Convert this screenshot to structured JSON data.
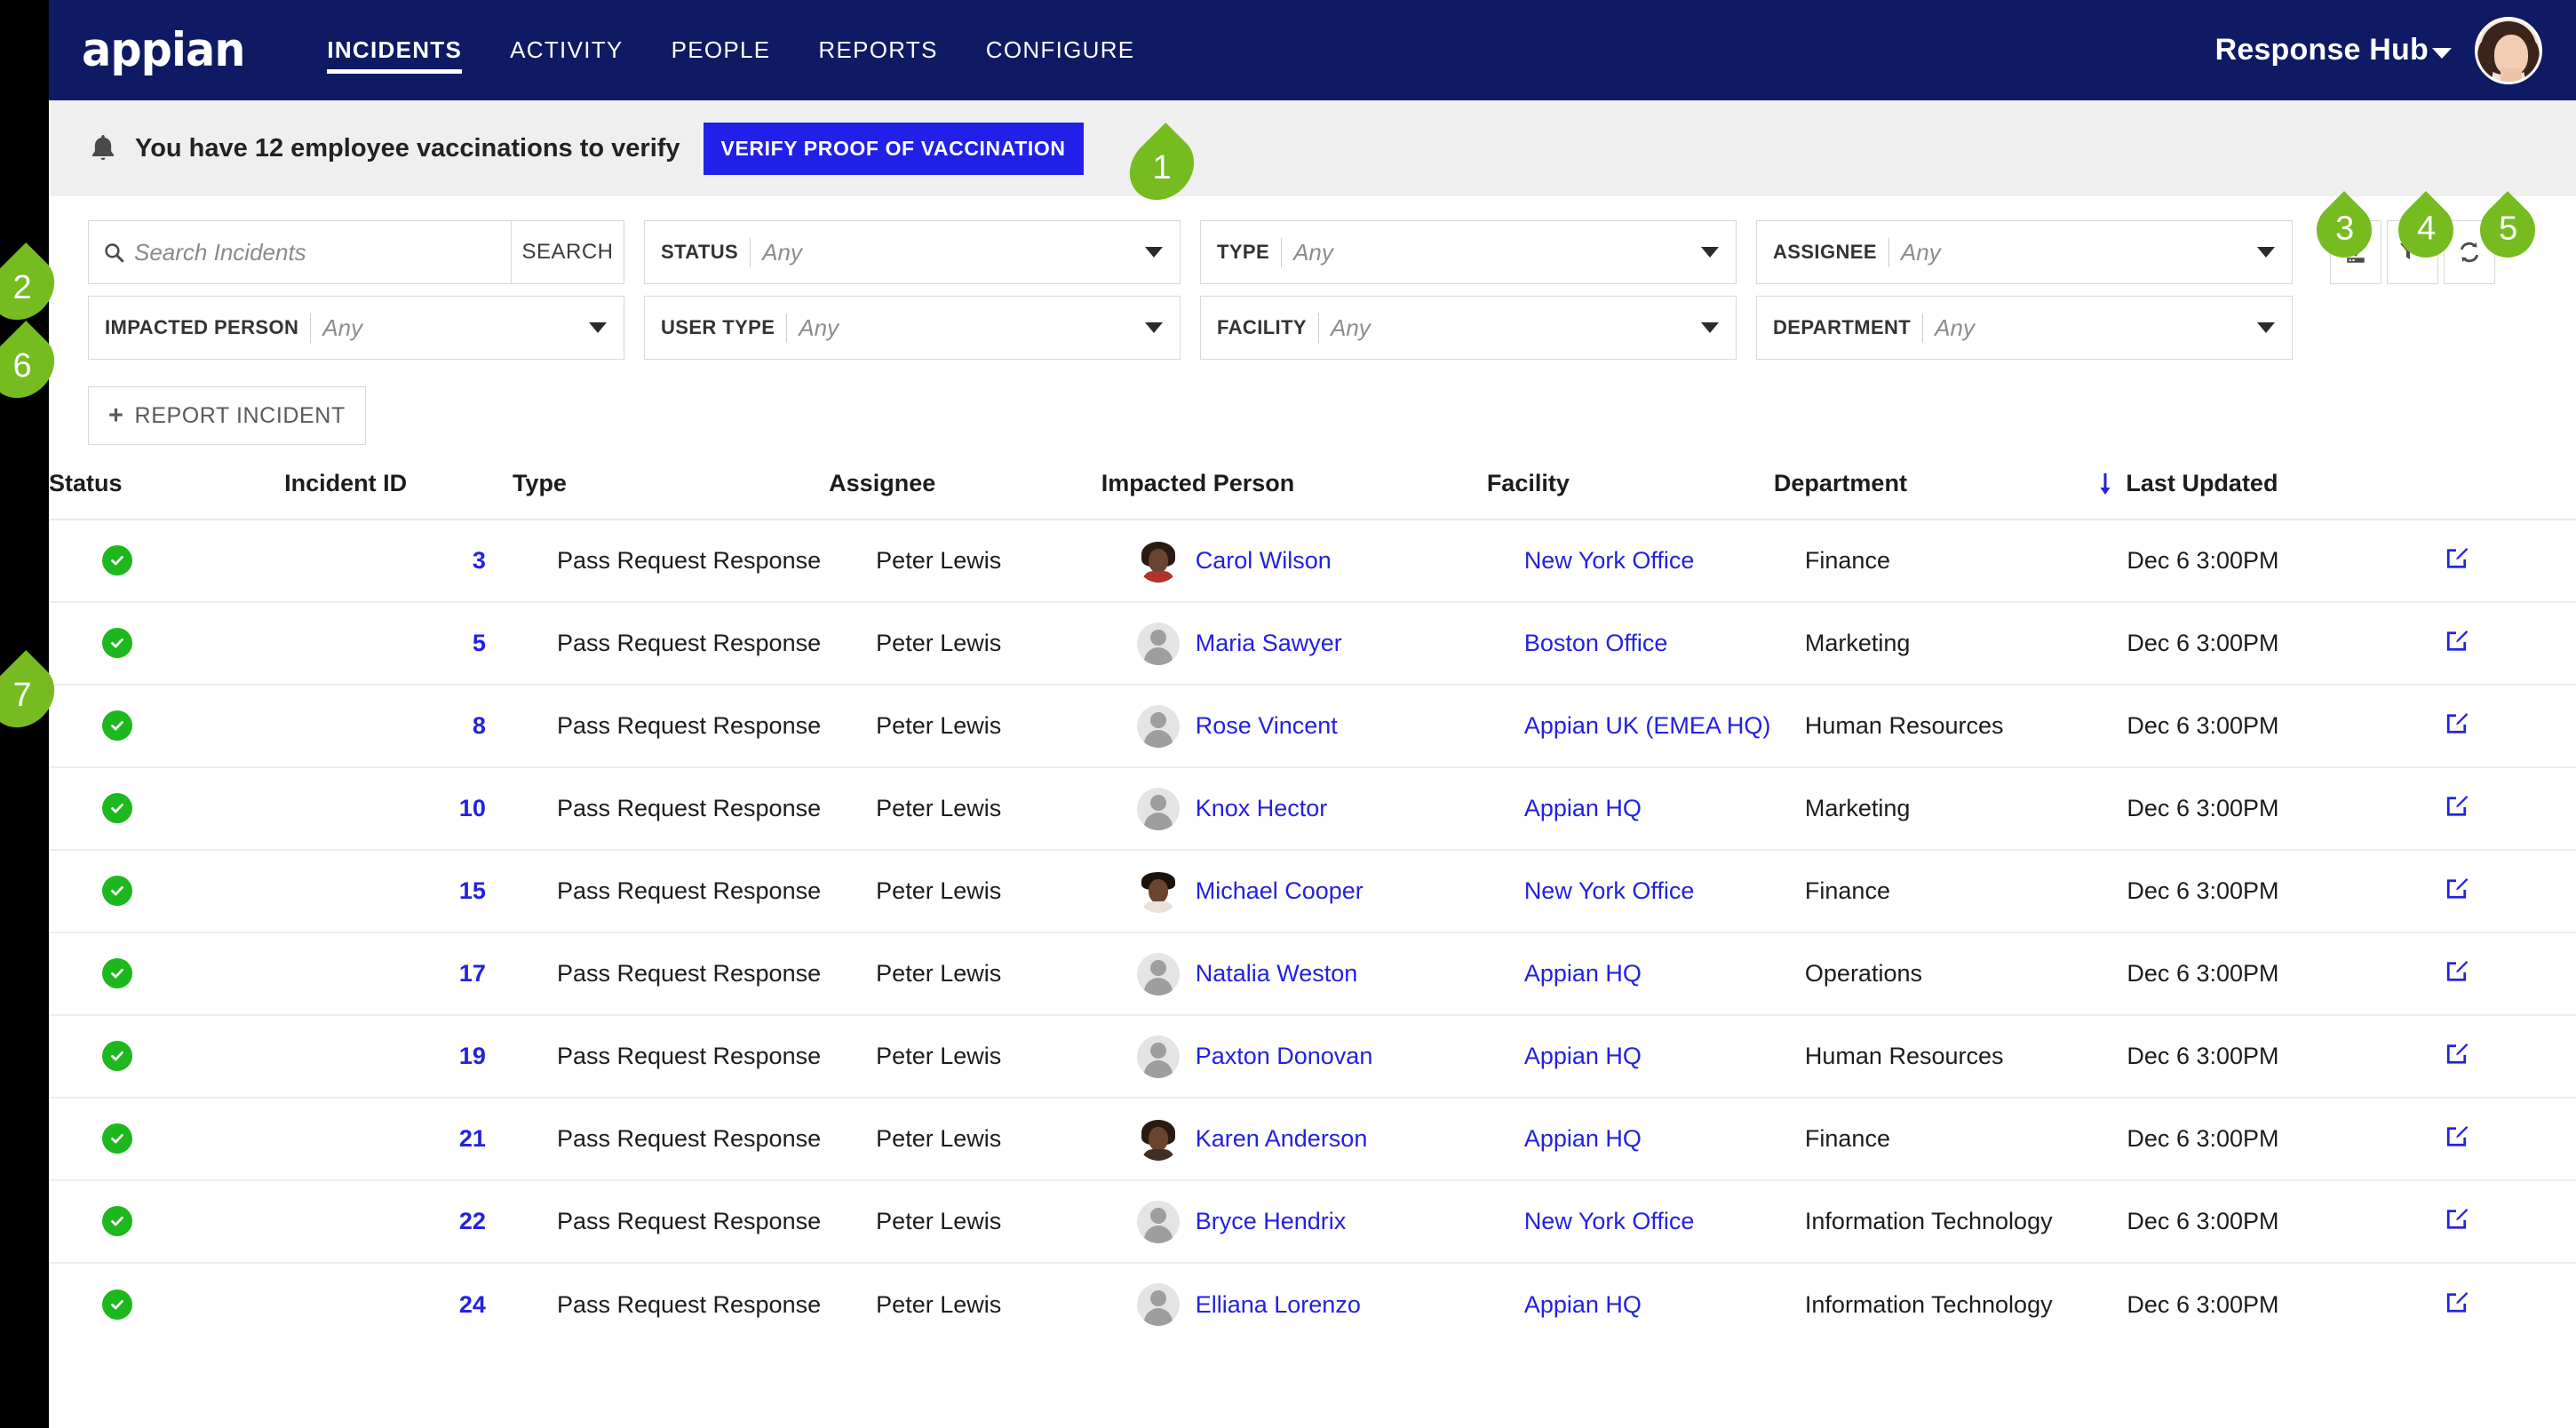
{
  "nav": {
    "brand": "appian",
    "links": [
      {
        "label": "INCIDENTS",
        "active": true
      },
      {
        "label": "ACTIVITY",
        "active": false
      },
      {
        "label": "PEOPLE",
        "active": false
      },
      {
        "label": "REPORTS",
        "active": false
      },
      {
        "label": "CONFIGURE",
        "active": false
      }
    ],
    "hub_name": "Response Hub"
  },
  "banner": {
    "message": "You have 12 employee vaccinations to verify",
    "button_label": "VERIFY PROOF OF VACCINATION"
  },
  "search": {
    "placeholder": "Search Incidents",
    "value": "",
    "button_label": "SEARCH"
  },
  "filters": [
    {
      "label": "STATUS",
      "value": "Any"
    },
    {
      "label": "TYPE",
      "value": "Any"
    },
    {
      "label": "ASSIGNEE",
      "value": "Any"
    },
    {
      "label": "IMPACTED PERSON",
      "value": "Any"
    },
    {
      "label": "USER TYPE",
      "value": "Any"
    },
    {
      "label": "FACILITY",
      "value": "Any"
    },
    {
      "label": "DEPARTMENT",
      "value": "Any"
    }
  ],
  "toolbar": {
    "export_icon": "download-icon",
    "filter_icon": "funnel-icon",
    "refresh_icon": "refresh-icon",
    "report_incident_label": "REPORT INCIDENT"
  },
  "table": {
    "headers": {
      "status": "Status",
      "incident_id": "Incident ID",
      "type": "Type",
      "assignee": "Assignee",
      "impacted_person": "Impacted Person",
      "facility": "Facility",
      "department": "Department",
      "last_updated": "Last Updated"
    },
    "sort": {
      "column": "Last Updated",
      "direction": "desc",
      "icon": "arrow-down-icon"
    },
    "rows": [
      {
        "status": "complete",
        "id": "3",
        "type": "Pass Request Response",
        "assignee": "Peter Lewis",
        "person": "Carol Wilson",
        "avatar": "photo",
        "facility": "New York Office",
        "department": "Finance",
        "updated": "Dec 6 3:00PM"
      },
      {
        "status": "complete",
        "id": "5",
        "type": "Pass Request Response",
        "assignee": "Peter Lewis",
        "person": "Maria Sawyer",
        "avatar": "placeholder",
        "facility": "Boston Office",
        "department": "Marketing",
        "updated": "Dec 6 3:00PM"
      },
      {
        "status": "complete",
        "id": "8",
        "type": "Pass Request Response",
        "assignee": "Peter Lewis",
        "person": "Rose Vincent",
        "avatar": "placeholder",
        "facility": "Appian UK (EMEA HQ)",
        "department": "Human Resources",
        "updated": "Dec 6 3:00PM"
      },
      {
        "status": "complete",
        "id": "10",
        "type": "Pass Request Response",
        "assignee": "Peter Lewis",
        "person": "Knox Hector",
        "avatar": "placeholder",
        "facility": "Appian HQ",
        "department": "Marketing",
        "updated": "Dec 6 3:00PM"
      },
      {
        "status": "complete",
        "id": "15",
        "type": "Pass Request Response",
        "assignee": "Peter Lewis",
        "person": "Michael Cooper",
        "avatar": "photo2",
        "facility": "New York Office",
        "department": "Finance",
        "updated": "Dec 6 3:00PM"
      },
      {
        "status": "complete",
        "id": "17",
        "type": "Pass Request Response",
        "assignee": "Peter Lewis",
        "person": "Natalia Weston",
        "avatar": "placeholder",
        "facility": "Appian HQ",
        "department": "Operations",
        "updated": "Dec 6 3:00PM"
      },
      {
        "status": "complete",
        "id": "19",
        "type": "Pass Request Response",
        "assignee": "Peter Lewis",
        "person": "Paxton Donovan",
        "avatar": "placeholder",
        "facility": "Appian HQ",
        "department": "Human Resources",
        "updated": "Dec 6 3:00PM"
      },
      {
        "status": "complete",
        "id": "21",
        "type": "Pass Request Response",
        "assignee": "Peter Lewis",
        "person": "Karen Anderson",
        "avatar": "photo3",
        "facility": "Appian HQ",
        "department": "Finance",
        "updated": "Dec 6 3:00PM"
      },
      {
        "status": "complete",
        "id": "22",
        "type": "Pass Request Response",
        "assignee": "Peter Lewis",
        "person": "Bryce Hendrix",
        "avatar": "placeholder",
        "facility": "New York Office",
        "department": "Information Technology",
        "updated": "Dec 6 3:00PM"
      },
      {
        "status": "complete",
        "id": "24",
        "type": "Pass Request Response",
        "assignee": "Peter Lewis",
        "person": "Elliana Lorenzo",
        "avatar": "placeholder",
        "facility": "Appian HQ",
        "department": "Information Technology",
        "updated": "Dec 6 3:00PM"
      }
    ]
  },
  "callouts": [
    {
      "number": "1",
      "shape": "left"
    },
    {
      "number": "2",
      "shape": "left"
    },
    {
      "number": "3",
      "shape": "down"
    },
    {
      "number": "4",
      "shape": "down"
    },
    {
      "number": "5",
      "shape": "down"
    },
    {
      "number": "6",
      "shape": "left"
    },
    {
      "number": "7",
      "shape": "left"
    }
  ],
  "colors": {
    "nav_bg": "#0e1a63",
    "accent_blue": "#2222e0",
    "callout_green": "#76bc21",
    "status_green": "#1db81d",
    "banner_bg": "#efefef"
  }
}
